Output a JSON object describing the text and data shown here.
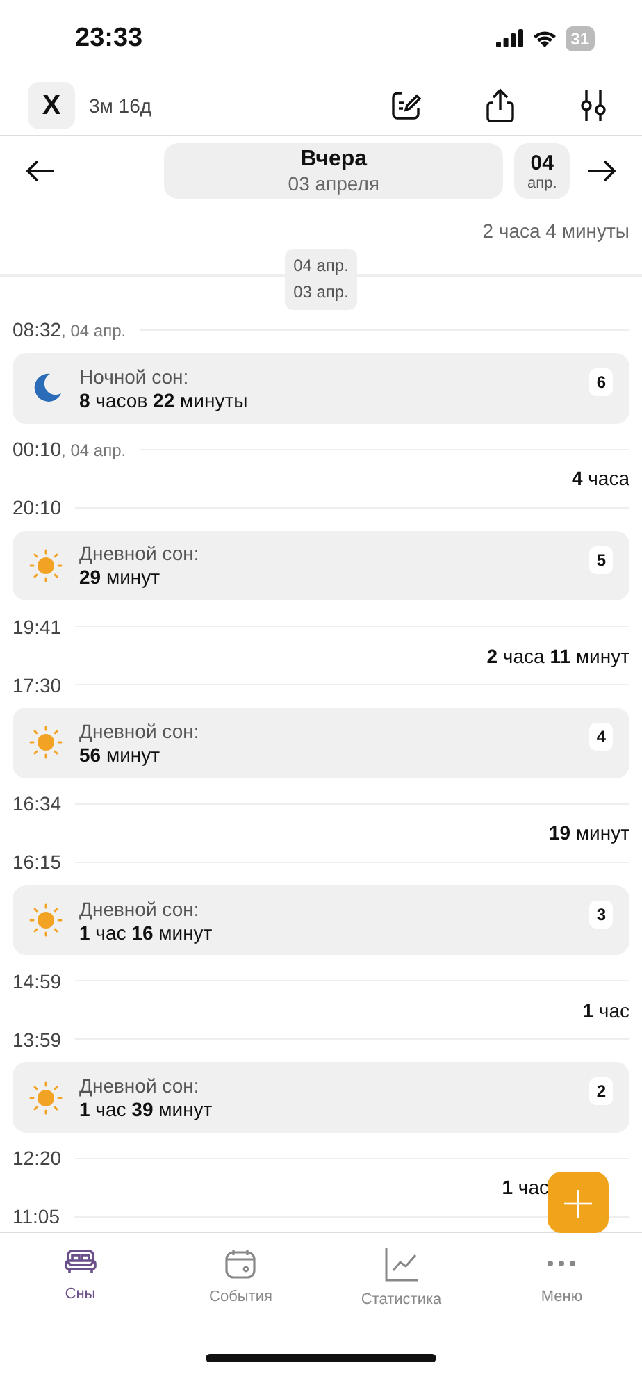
{
  "status_bar": {
    "time": "23:33",
    "battery": "31"
  },
  "toolbar": {
    "close_label": "X",
    "age": "3м 16д"
  },
  "date_nav": {
    "title": "Вчера",
    "subtitle": "03 апреля",
    "next_day": "04",
    "next_month": "апр."
  },
  "timeline": [
    {
      "kind": "gap",
      "text": "2 часа 4 минуты",
      "dimmed": true
    },
    {
      "kind": "divider",
      "top": "04 апр.",
      "bottom": "03 апр."
    },
    {
      "kind": "time",
      "time": "08:32",
      "date": ", 04 апр."
    },
    {
      "kind": "night_sleep",
      "label": "Ночной сон:",
      "duration": "**8** часов **22** минуты",
      "count": "6"
    },
    {
      "kind": "time",
      "time": "00:10",
      "date": ", 04 апр."
    },
    {
      "kind": "gap",
      "text": "**4** часа",
      "dimmed": false
    },
    {
      "kind": "time",
      "time": "20:10"
    },
    {
      "kind": "day_sleep",
      "label": "Дневной сон:",
      "duration": "**29** минут",
      "count": "5"
    },
    {
      "kind": "time",
      "time": "19:41"
    },
    {
      "kind": "gap",
      "text": "**2** часа **11** минут",
      "dimmed": false
    },
    {
      "kind": "time",
      "time": "17:30"
    },
    {
      "kind": "day_sleep",
      "label": "Дневной сон:",
      "duration": "**56** минут",
      "count": "4"
    },
    {
      "kind": "time",
      "time": "16:34"
    },
    {
      "kind": "gap",
      "text": "**19** минут",
      "dimmed": false
    },
    {
      "kind": "time",
      "time": "16:15"
    },
    {
      "kind": "day_sleep",
      "label": "Дневной сон:",
      "duration": "**1** час **16** минут",
      "count": "3"
    },
    {
      "kind": "time",
      "time": "14:59"
    },
    {
      "kind": "gap",
      "text": "**1** час",
      "dimmed": false
    },
    {
      "kind": "time",
      "time": "13:59"
    },
    {
      "kind": "day_sleep",
      "label": "Дневной сон:",
      "duration": "**1** час **39** минут",
      "count": "2"
    },
    {
      "kind": "time",
      "time": "12:20"
    },
    {
      "kind": "gap",
      "text": "**1** час",
      "dimmed": false
    },
    {
      "kind": "time",
      "time": "11:05"
    }
  ],
  "fab": {
    "label": "+"
  },
  "tabs": [
    {
      "label": "Сны",
      "selected": true
    },
    {
      "label": "События",
      "selected": false
    },
    {
      "label": "Статистика",
      "selected": false
    },
    {
      "label": "Меню",
      "selected": false
    }
  ]
}
